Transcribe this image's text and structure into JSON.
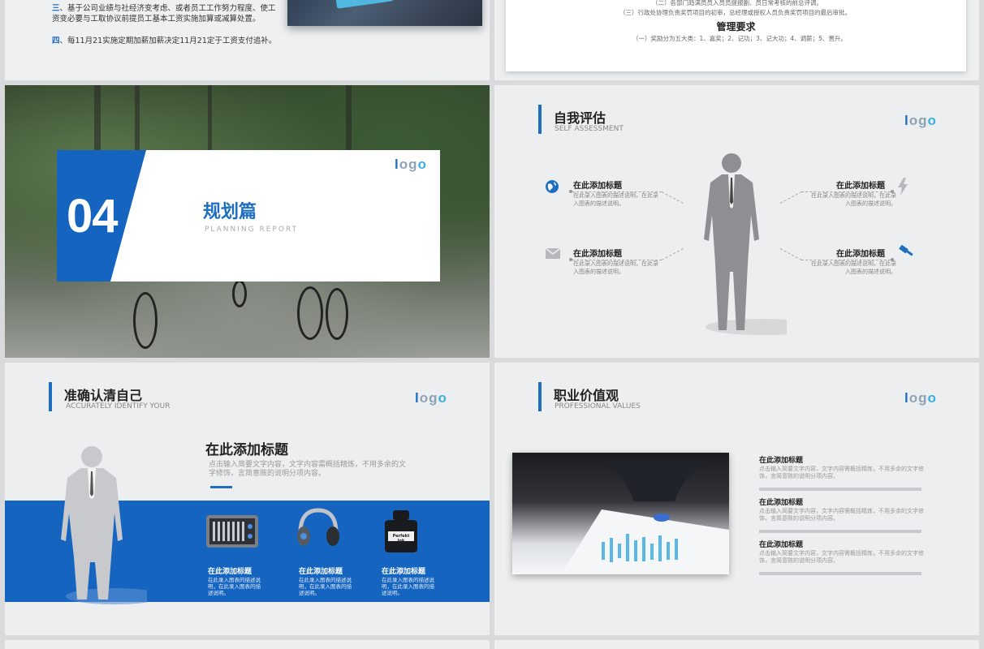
{
  "slide1": {
    "para3_num": "三",
    "para3": "、基于公司业绩与社经济变考虑、或者员工工作努力程度、使工资变必要与工取协议前提员工基本工资实施加算或减算处置。",
    "para4_num": "四",
    "para4": "、每11月21实施定期加薪加薪决定11月21定于工资支付追补。"
  },
  "slide2": {
    "line1": "（二）各部门趋满员员入员员提报副、员日常考核的前总评调。",
    "line2": "（三）行政处协理负责奖罚项目的初审，总经理或授权人员负责奖罚项目的最后审批。",
    "heading": "管理要求",
    "line3": "（一）奖励分为五大类：1、嘉奖；2、记功；3、记大功；4、调薪；5、晋升。"
  },
  "slide3": {
    "number": "04",
    "title": "规划篇",
    "subtitle": "PLANNING REPORT"
  },
  "logo": [
    "l",
    "o",
    "g",
    "o"
  ],
  "slide4": {
    "title": "自我评估",
    "subtitle": "SELF ASSESSMENT",
    "items": [
      {
        "title": "在此添加标题",
        "desc": "在此录入图表的描述说明，在此录入图表的描述说明。",
        "icon": "globe-icon"
      },
      {
        "title": "在此添加标题",
        "desc": "在此录入图表的描述说明，在此录入图表的描述说明。",
        "icon": "envelope-icon"
      },
      {
        "title": "在此添加标题",
        "desc": "在此录入图表的描述说明，在此录入图表的描述说明。",
        "icon": "lightning-icon"
      },
      {
        "title": "在此添加标题",
        "desc": "在此录入图表的描述说明，在此录入图表的描述说明。",
        "icon": "gavel-icon"
      }
    ]
  },
  "slide5": {
    "title": "准确认清自己",
    "subtitle": "ACCURATELY IDENTIFY YOUR",
    "heading": "在此添加标题",
    "para": "点击输入简要文字内容，文字内容需概括精炼，不用多余的文字修饰，言简意赅的说明分项内容。",
    "items": [
      {
        "title": "在此添加标题",
        "desc": "在此录入图表的描述说明，在此录入图表的描述说明。",
        "icon": "equalizer-icon"
      },
      {
        "title": "在此添加标题",
        "desc": "在此录入图表的描述说明，在此录入图表的描述说明。",
        "icon": "headphones-icon"
      },
      {
        "title": "在此添加标题",
        "desc": "在此录入图表的描述说明，在此录入图表的描述说明。",
        "icon": "ink-bottle-icon"
      }
    ],
    "ink_label": "Perfekt Ink"
  },
  "slide6": {
    "title": "职业价值观",
    "subtitle": "PROFESSIONAL VALUES",
    "items": [
      {
        "title": "在此添加标题",
        "desc": "点击输入简要文字内容，文字内容需概括精炼，不用多余的文字修饰，言简意赅的说明分项内容。"
      },
      {
        "title": "在此添加标题",
        "desc": "点击输入简要文字内容，文字内容需概括精炼，不用多余的文字修饰，言简意赅的说明分项内容。"
      },
      {
        "title": "在此添加标题",
        "desc": "点击输入简要文字内容，文字内容需概括精炼，不用多余的文字修饰，言简意赅的说明分项内容。"
      }
    ]
  },
  "colors": {
    "accent": "#1565c0",
    "logo_light": "#38b0e0"
  }
}
